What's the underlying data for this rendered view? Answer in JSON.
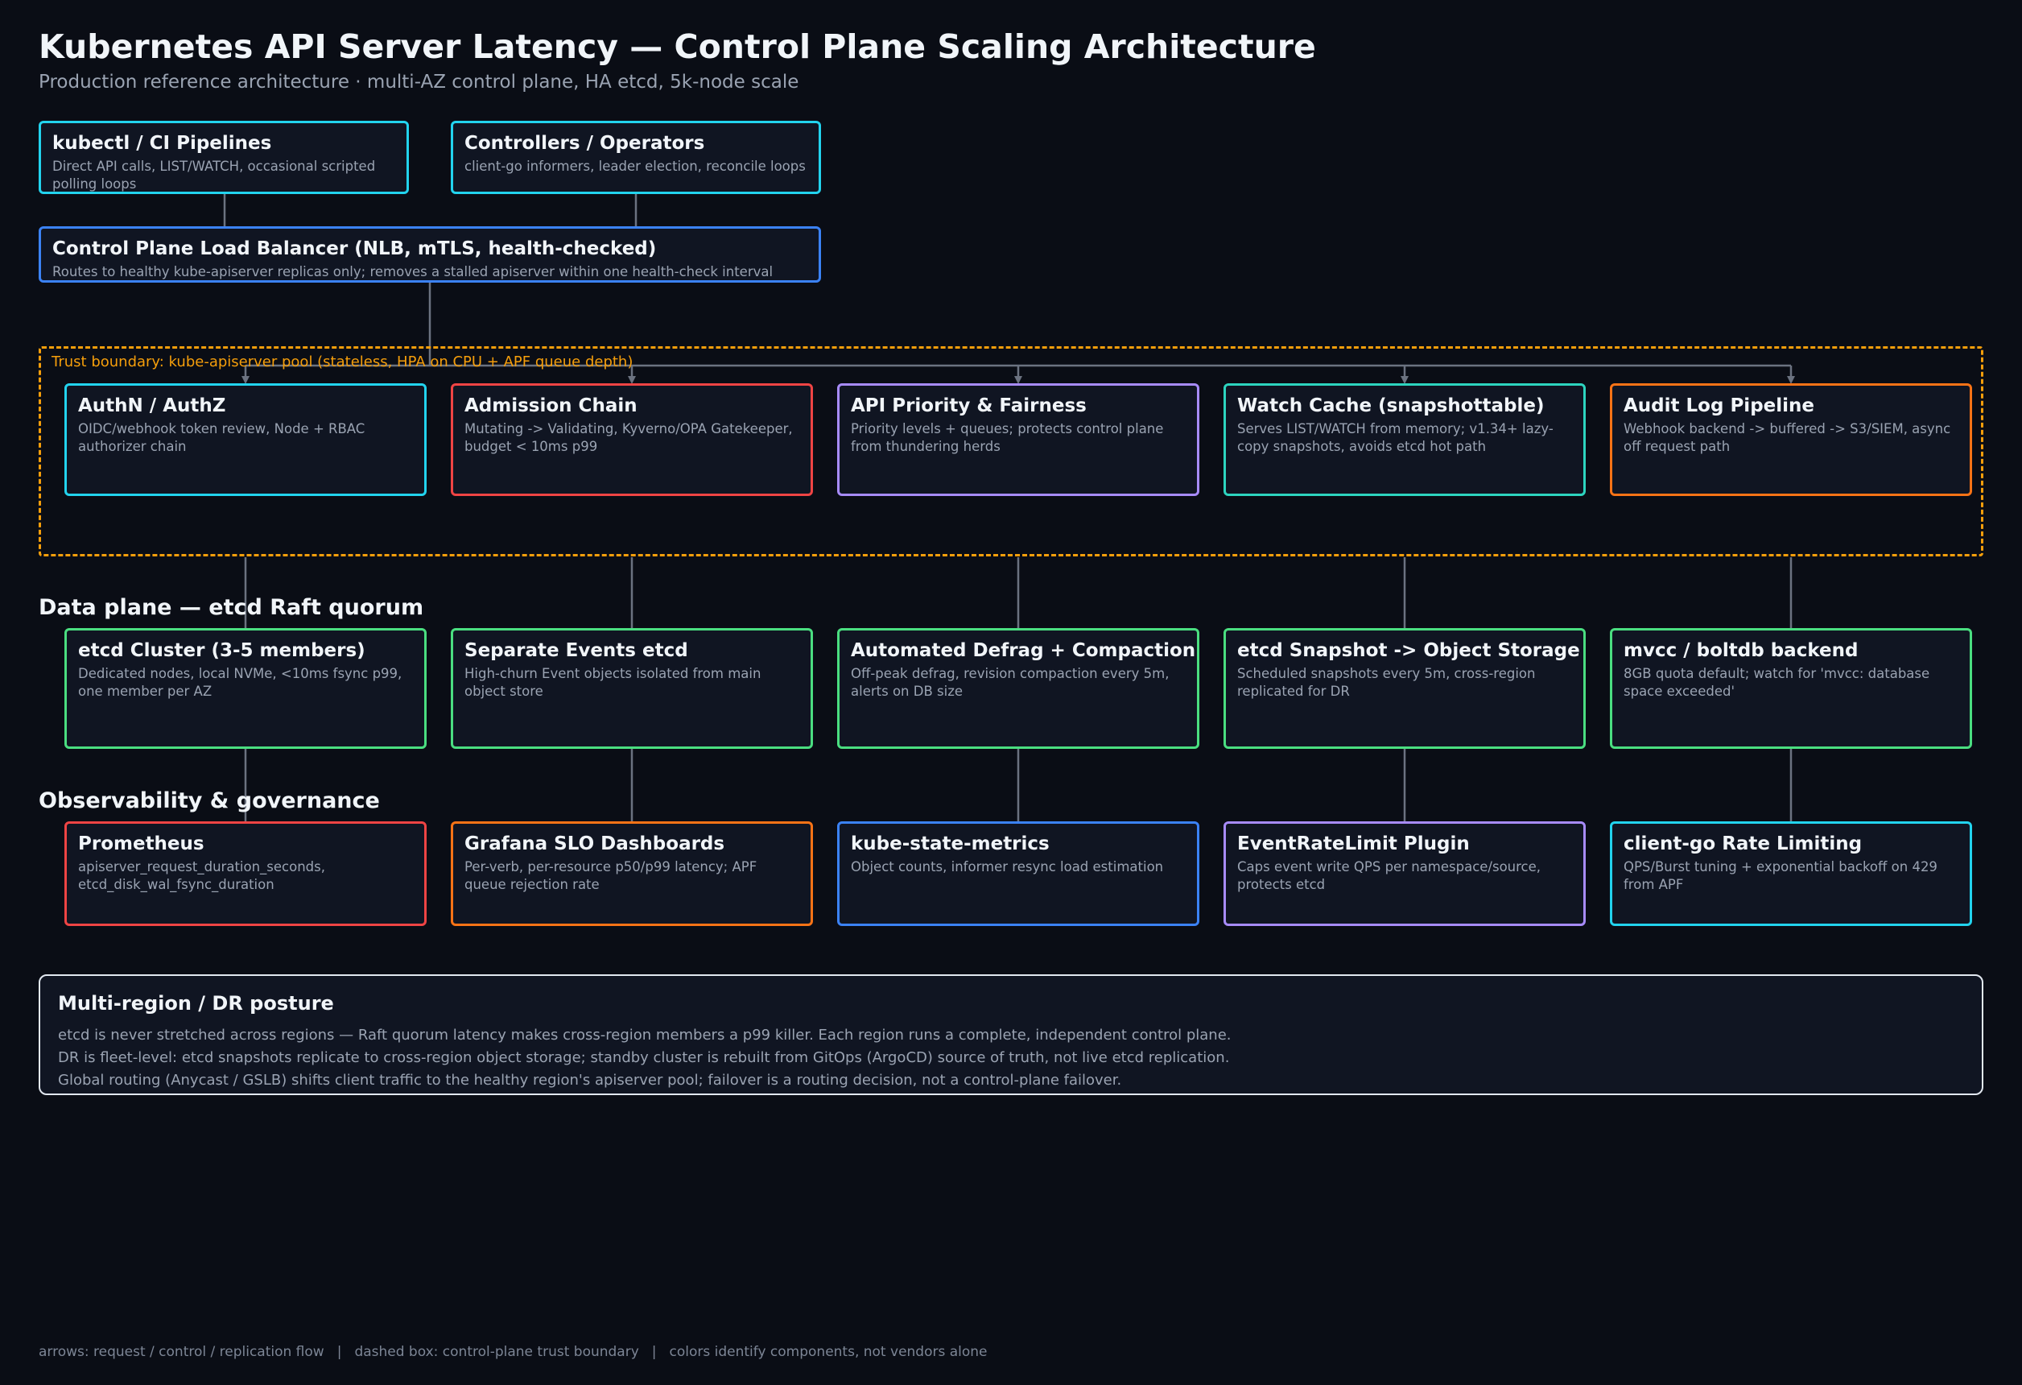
{
  "header": {
    "title": "Kubernetes API Server Latency — Control Plane Scaling Architecture",
    "subtitle": "Production reference architecture · multi-AZ control plane, HA etcd, 5k-node scale"
  },
  "clients": [
    {
      "title": "kubectl / CI Pipelines",
      "desc": "Direct API calls, LIST/WATCH, occasional scripted polling loops",
      "color": "#22d3ee"
    },
    {
      "title": "Controllers / Operators",
      "desc": "client-go informers, leader election, reconcile loops",
      "color": "#22d3ee"
    }
  ],
  "load_balancer": {
    "title": "Control Plane Load Balancer (NLB, mTLS, health-checked)",
    "desc": "Routes to healthy kube-apiserver replicas only; removes a stalled apiserver within one health-check interval",
    "color": "#3b82f6"
  },
  "trust_boundary": {
    "label": "Trust boundary: kube-apiserver pool (stateless, HPA on CPU + APF queue depth)",
    "color": "#f59e0b"
  },
  "apiserver": [
    {
      "title": "AuthN / AuthZ",
      "desc": "OIDC/webhook token review, Node + RBAC authorizer chain",
      "color": "#22d3ee"
    },
    {
      "title": "Admission Chain",
      "desc": "Mutating -> Validating, Kyverno/OPA Gatekeeper, budget < 10ms p99",
      "color": "#ef4444"
    },
    {
      "title": "API Priority & Fairness",
      "desc": "Priority levels + queues; protects control plane from thundering herds",
      "color": "#a78bfa"
    },
    {
      "title": "Watch Cache (snapshottable)",
      "desc": "Serves LIST/WATCH from memory; v1.34+ lazy-copy snapshots, avoids etcd hot path",
      "color": "#2dd4bf"
    },
    {
      "title": "Audit Log Pipeline",
      "desc": "Webhook backend -> buffered -> S3/SIEM, async off request path",
      "color": "#f97316"
    }
  ],
  "data_plane": {
    "heading": "Data plane — etcd Raft quorum",
    "items": [
      {
        "title": "etcd Cluster (3-5 members)",
        "desc": "Dedicated nodes, local NVMe, <10ms fsync p99, one member per AZ",
        "color": "#4ade80"
      },
      {
        "title": "Separate Events etcd",
        "desc": "High-churn Event objects isolated from main object store",
        "color": "#4ade80"
      },
      {
        "title": "Automated Defrag + Compaction",
        "desc": "Off-peak defrag, revision compaction every 5m, alerts on DB size",
        "color": "#4ade80"
      },
      {
        "title": "etcd Snapshot -> Object Storage",
        "desc": "Scheduled snapshots every 5m, cross-region replicated for DR",
        "color": "#4ade80"
      },
      {
        "title": "mvcc / boltdb backend",
        "desc": "8GB quota default; watch for 'mvcc: database space exceeded'",
        "color": "#4ade80"
      }
    ]
  },
  "observability": {
    "heading": "Observability & governance",
    "items": [
      {
        "title": "Prometheus",
        "desc": "apiserver_request_duration_seconds, etcd_disk_wal_fsync_duration",
        "color": "#ef4444"
      },
      {
        "title": "Grafana SLO Dashboards",
        "desc": "Per-verb, per-resource p50/p99 latency; APF queue rejection rate",
        "color": "#f97316"
      },
      {
        "title": "kube-state-metrics",
        "desc": "Object counts, informer resync load estimation",
        "color": "#3b82f6"
      },
      {
        "title": "EventRateLimit Plugin",
        "desc": "Caps event write QPS per namespace/source, protects etcd",
        "color": "#a78bfa"
      },
      {
        "title": "client-go Rate Limiting",
        "desc": "QPS/Burst tuning + exponential backoff on 429 from APF",
        "color": "#22d3ee"
      }
    ]
  },
  "dr": {
    "title": "Multi-region / DR posture",
    "lines": [
      "etcd is never stretched across regions — Raft quorum latency makes cross-region members a p99 killer. Each region runs a complete, independent control plane.",
      "DR is fleet-level: etcd snapshots replicate to cross-region object storage; standby cluster is rebuilt from GitOps (ArgoCD) source of truth, not live etcd replication.",
      "Global routing (Anycast / GSLB) shifts client traffic to the healthy region's apiserver pool; failover is a routing decision, not a control-plane failover."
    ]
  },
  "legend": [
    "arrows: request / control / replication flow",
    "dashed box: control-plane trust boundary",
    "colors identify components, not vendors alone"
  ],
  "style": {
    "wire_color": "#6b7280",
    "background": "#0a0d15"
  }
}
